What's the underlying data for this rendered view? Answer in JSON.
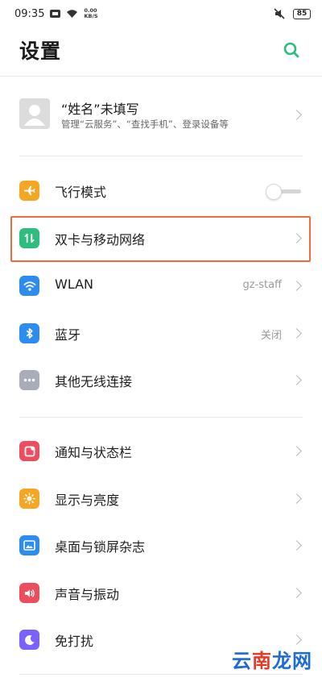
{
  "status_bar": {
    "time": "09:35",
    "speed_value": "0.00",
    "speed_unit": "KB/S",
    "battery": "85"
  },
  "header": {
    "title": "设置"
  },
  "account": {
    "name": "“姓名”未填写",
    "subtitle": "管理“云服务”、“查找手机”、登录设备等"
  },
  "sections": [
    {
      "items": [
        {
          "label": "飞行模式",
          "icon": "airplane-icon",
          "color": "#F5A623",
          "control": "toggle",
          "toggle_on": false
        },
        {
          "label": "双卡与移动网络",
          "icon": "dual-sim-icon",
          "color": "#2DBE7E",
          "control": "chevron",
          "highlighted": true
        },
        {
          "label": "WLAN",
          "icon": "wifi-icon",
          "color": "#2D8CF0",
          "value": "gz-staff",
          "control": "chevron"
        },
        {
          "label": "蓝牙",
          "icon": "bluetooth-icon",
          "color": "#2D8CF0",
          "value": "关闭",
          "control": "chevron"
        },
        {
          "label": "其他无线连接",
          "icon": "more-connections-icon",
          "color": "#A9ADB8",
          "control": "chevron"
        }
      ]
    },
    {
      "items": [
        {
          "label": "通知与状态栏",
          "icon": "notification-icon",
          "color": "#EE4D5F",
          "control": "chevron"
        },
        {
          "label": "显示与亮度",
          "icon": "brightness-icon",
          "color": "#F5A623",
          "control": "chevron"
        },
        {
          "label": "桌面与锁屏杂志",
          "icon": "wallpaper-icon",
          "color": "#2D8CF0",
          "control": "chevron"
        },
        {
          "label": "声音与振动",
          "icon": "sound-icon",
          "color": "#EE4D5F",
          "control": "chevron"
        },
        {
          "label": "免打扰",
          "icon": "do-not-disturb-icon",
          "color": "#7B61FF",
          "control": "chevron"
        }
      ]
    }
  ],
  "accent_color": "#2DBE7E",
  "highlight_color": "#F06B3C",
  "watermark": {
    "part1": "云",
    "part2": "南",
    "part3": "龙网"
  }
}
